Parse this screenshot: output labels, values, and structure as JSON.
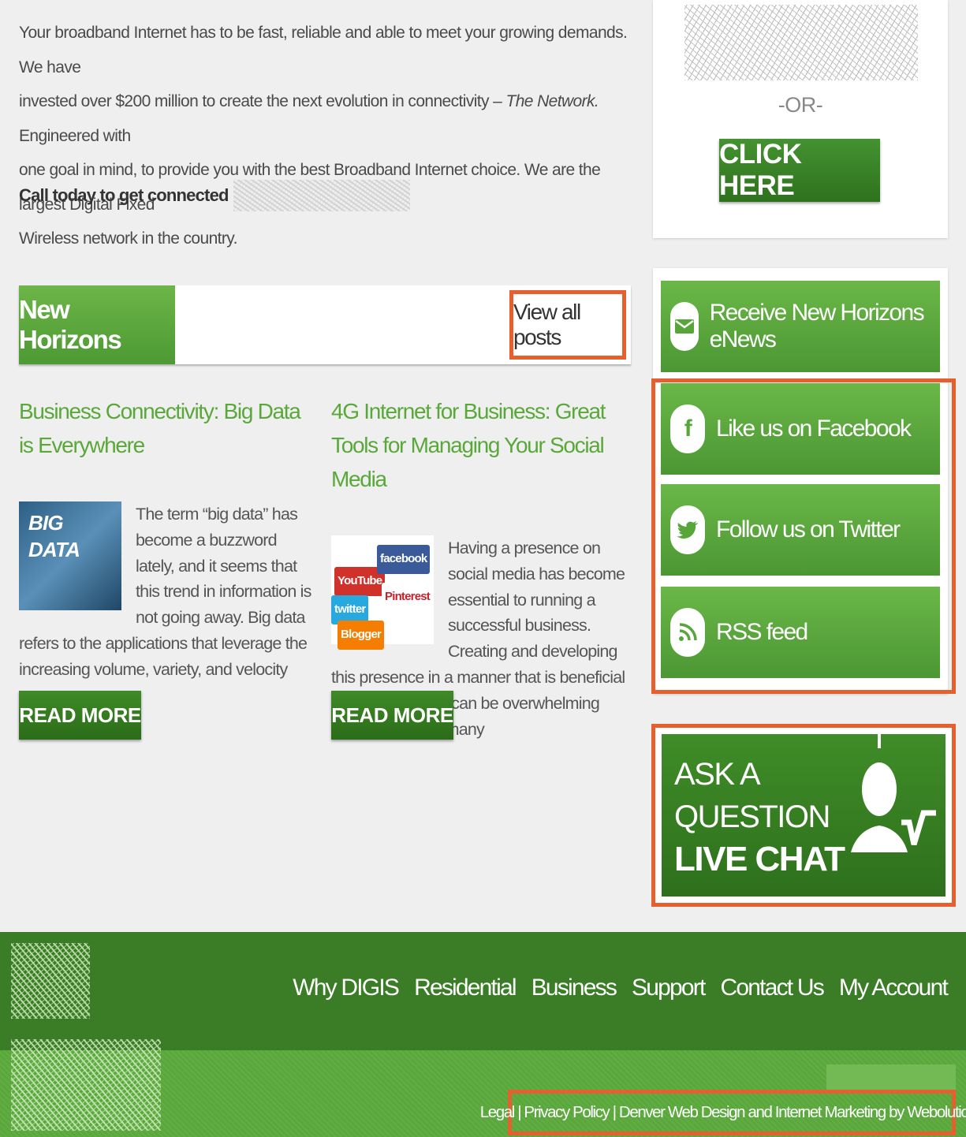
{
  "intro": {
    "line1": "Your broadband Internet has to be fast, reliable and able to meet your growing demands.  We have",
    "line2_pre": "invested over $200 million to create the next evolution in connectivity – ",
    "line2_em": "The Network.",
    "line2_post": "  Engineered with",
    "line3": "one goal in mind, to provide you with the best Broadband Internet choice. We are the largest Digital Fixed",
    "line4": "Wireless network in the country.",
    "call": "Call today to get connected"
  },
  "blog": {
    "title": "New Horizons",
    "view_all": "View all posts",
    "posts": [
      {
        "title": "Business Connectivity: Big Data is Everywhere",
        "thumb_text": "BIG DATA",
        "excerpt": "The term “big data” has become a buzzword lately, and it seems that this trend in information is not going away. Big data refers to the applications that leverage the increasing volume, variety, and velocity",
        "read_more": "READ MORE"
      },
      {
        "title": "4G Internet for Business: Great Tools for Managing Your Social Media",
        "thumb_labels": [
          "YouTube",
          "facebook",
          "twitter",
          "Pinterest",
          "Blogger"
        ],
        "excerpt": "Having a presence on social media has become essential to running a successful business. Creating and developing this presence in a manner that is beneficial to your company can be overwhelming because of how many",
        "read_more": "READ MORE"
      }
    ]
  },
  "sidebar": {
    "or_text": "-OR-",
    "click_here": "CLICK HERE",
    "buttons": [
      {
        "label": "Receive New Horizons eNews",
        "icon": "envelope-icon"
      },
      {
        "label": "Like us on Facebook",
        "icon": "facebook-icon"
      },
      {
        "label": "Follow us on Twitter",
        "icon": "twitter-icon"
      },
      {
        "label": "RSS feed",
        "icon": "rss-icon"
      }
    ],
    "chat": {
      "line1": "ASK A",
      "line2": "QUESTION",
      "line3": "LIVE CHAT"
    }
  },
  "footer": {
    "nav": [
      "Why DIGIS",
      "Residential",
      "Business",
      "Support",
      "Contact Us",
      "My Account"
    ],
    "links": "Legal | Privacy Policy | Denver Web Design and Internet Marketing by Webolutions"
  },
  "colors": {
    "accent_green": "#5aa83a",
    "dark_green": "#3a7d26",
    "highlight_orange": "#e5602e"
  }
}
